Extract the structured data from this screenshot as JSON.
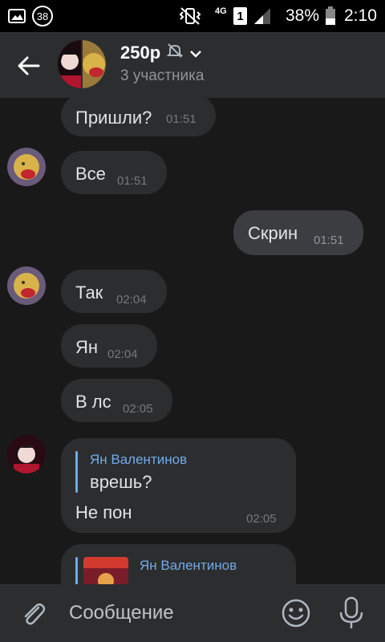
{
  "status_bar": {
    "notification_count": "38",
    "network": "4G",
    "sim_slot": "1",
    "battery": "38%",
    "time": "2:10",
    "icons": [
      "gallery-icon",
      "notification-badge-icon",
      "vibrate-icon",
      "network-4g-icon",
      "sim-icon",
      "signal-icon",
      "battery-icon"
    ]
  },
  "header": {
    "title": "250р",
    "subtitle": "3 участника",
    "icons": [
      "back-arrow-icon",
      "muted-icon",
      "chevron-down-icon"
    ]
  },
  "messages": [
    {
      "text": "Пришли?",
      "time": "01:51",
      "side": "left"
    },
    {
      "text": "Все",
      "time": "01:51",
      "side": "left"
    },
    {
      "text": "Скрин",
      "time": "01:51",
      "side": "right"
    },
    {
      "text": "Так",
      "time": "02:04",
      "side": "left"
    },
    {
      "text": "Ян",
      "time": "02:04",
      "side": "left"
    },
    {
      "text": "В лс",
      "time": "02:05",
      "side": "left"
    },
    {
      "reply_author": "Ян Валентинов",
      "reply_text": "врешь?",
      "text": "Не пон",
      "time": "02:05",
      "side": "left"
    },
    {
      "reply_author": "Ян Валентинов",
      "side": "left"
    }
  ],
  "composer": {
    "placeholder": "Сообщение",
    "icons": [
      "attach-icon",
      "emoji-icon",
      "microphone-icon"
    ]
  },
  "colors": {
    "background": "#19191a",
    "bubble": "#2c2d2e",
    "accent": "#71aaeb",
    "muted_text": "#76787a"
  }
}
